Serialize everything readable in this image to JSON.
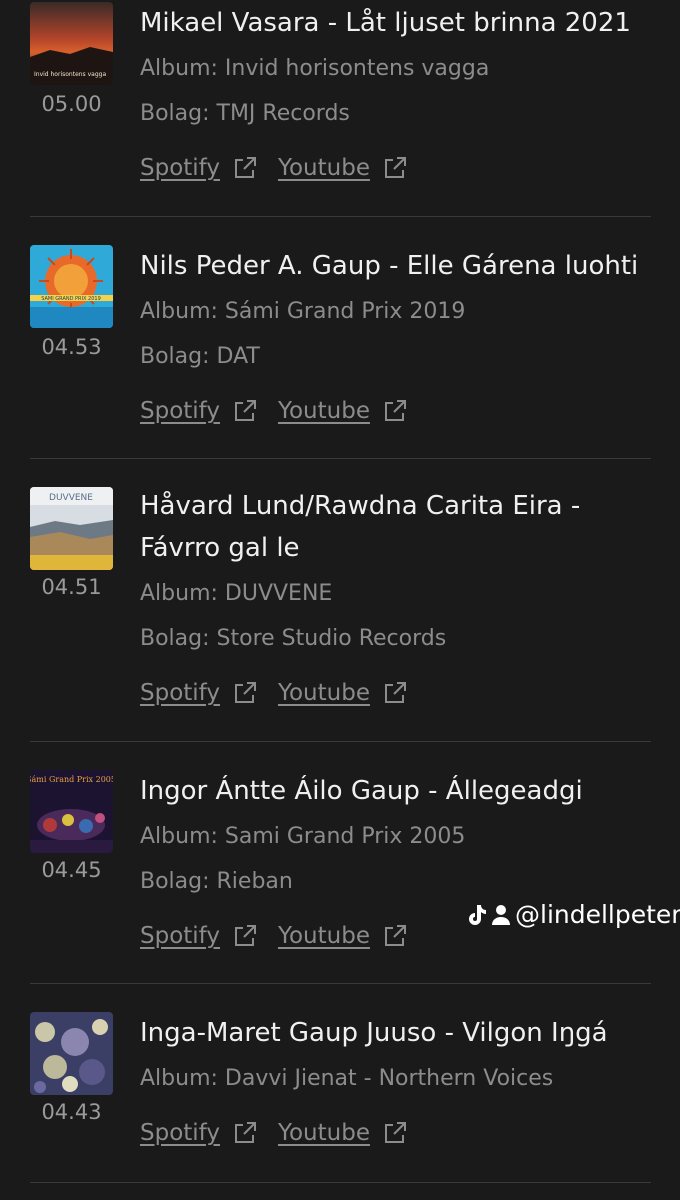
{
  "tracks": [
    {
      "title": "Mikael Vasara - Låt ljuset brinna 2021",
      "duration": "05.00",
      "album": "Album: Invid horisontens vagga",
      "label": "Bolag: TMJ Records",
      "cover_text": "Invid horisontens vagga",
      "spotify": "Spotify",
      "youtube": "Youtube"
    },
    {
      "title": "Nils Peder A. Gaup - Elle Gárena luohti",
      "duration": "04.53",
      "album": "Album: Sámi Grand Prix 2019",
      "label": "Bolag: DAT",
      "cover_text": "SAMI GRAND PRIX 2019",
      "spotify": "Spotify",
      "youtube": "Youtube"
    },
    {
      "title": "Håvard Lund/Rawdna Carita Eira -",
      "title_line2": "Fávrro gal le",
      "duration": "04.51",
      "album": "Album: DUVVENE",
      "label": "Bolag: Store Studio Records",
      "cover_text": "DUVVENE",
      "spotify": "Spotify",
      "youtube": "Youtube"
    },
    {
      "title": "Ingor Ántte Áilo Gaup - Állegeadgi",
      "duration": "04.45",
      "album": "Album: Sami Grand Prix 2005",
      "label": "Bolag: Rieban",
      "cover_text": "Sámi Grand Prix 2005",
      "spotify": "Spotify",
      "youtube": "Youtube"
    },
    {
      "title": "Inga-Maret Gaup Juuso - Vilgon Iŋgá",
      "duration": "04.43",
      "album": "Album: Davvi Jienat - Northern Voices",
      "spotify": "Spotify",
      "youtube": "Youtube"
    }
  ],
  "watermark": {
    "handle": "@lindellpeter",
    "icons": [
      "tiktok-icon",
      "user-icon"
    ]
  },
  "colors": {
    "background": "#1a1a1a",
    "text": "#f0f0f0",
    "muted": "#8c8c8c",
    "divider": "#3a3a3a"
  }
}
